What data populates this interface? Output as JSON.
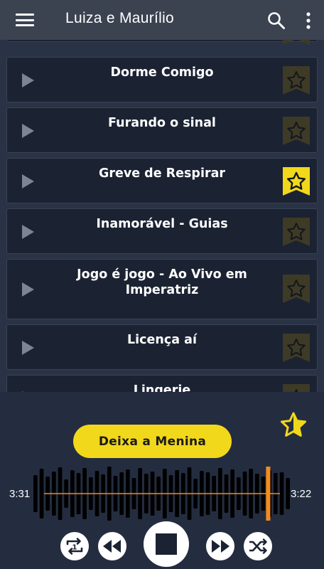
{
  "app": {
    "title": "Luiza e Maurílio"
  },
  "songs": [
    {
      "title": "",
      "favorite": false
    },
    {
      "title": "Dorme Comigo",
      "favorite": false
    },
    {
      "title": "Furando o sinal",
      "favorite": false
    },
    {
      "title": "Greve de Respirar",
      "favorite": true
    },
    {
      "title": "Inamorável - Guias",
      "favorite": false
    },
    {
      "title": "Jogo é jogo - Ao Vivo em Imperatriz",
      "favorite": false
    },
    {
      "title": "Licença aí",
      "favorite": false
    },
    {
      "title": "Lingerie",
      "favorite": false
    }
  ],
  "player": {
    "now_playing": "Deixa a Menina",
    "elapsed": "3:31",
    "remaining": "3:22",
    "progress": 0.95
  },
  "icons": {
    "menu": "menu-icon",
    "search": "search-icon",
    "more": "more-vert-icon",
    "play": "play-icon",
    "favorite": "star-icon",
    "repeat": "repeat-one-icon",
    "rewind": "rewind-icon",
    "stop": "stop-icon",
    "fast_forward": "fast-forward-icon",
    "shuffle": "shuffle-icon"
  },
  "colors": {
    "accent": "#f2d81b",
    "progress": "#f58a1f",
    "background": "#2a3345",
    "card": "#1b2232",
    "appbar": "#3b4250"
  }
}
